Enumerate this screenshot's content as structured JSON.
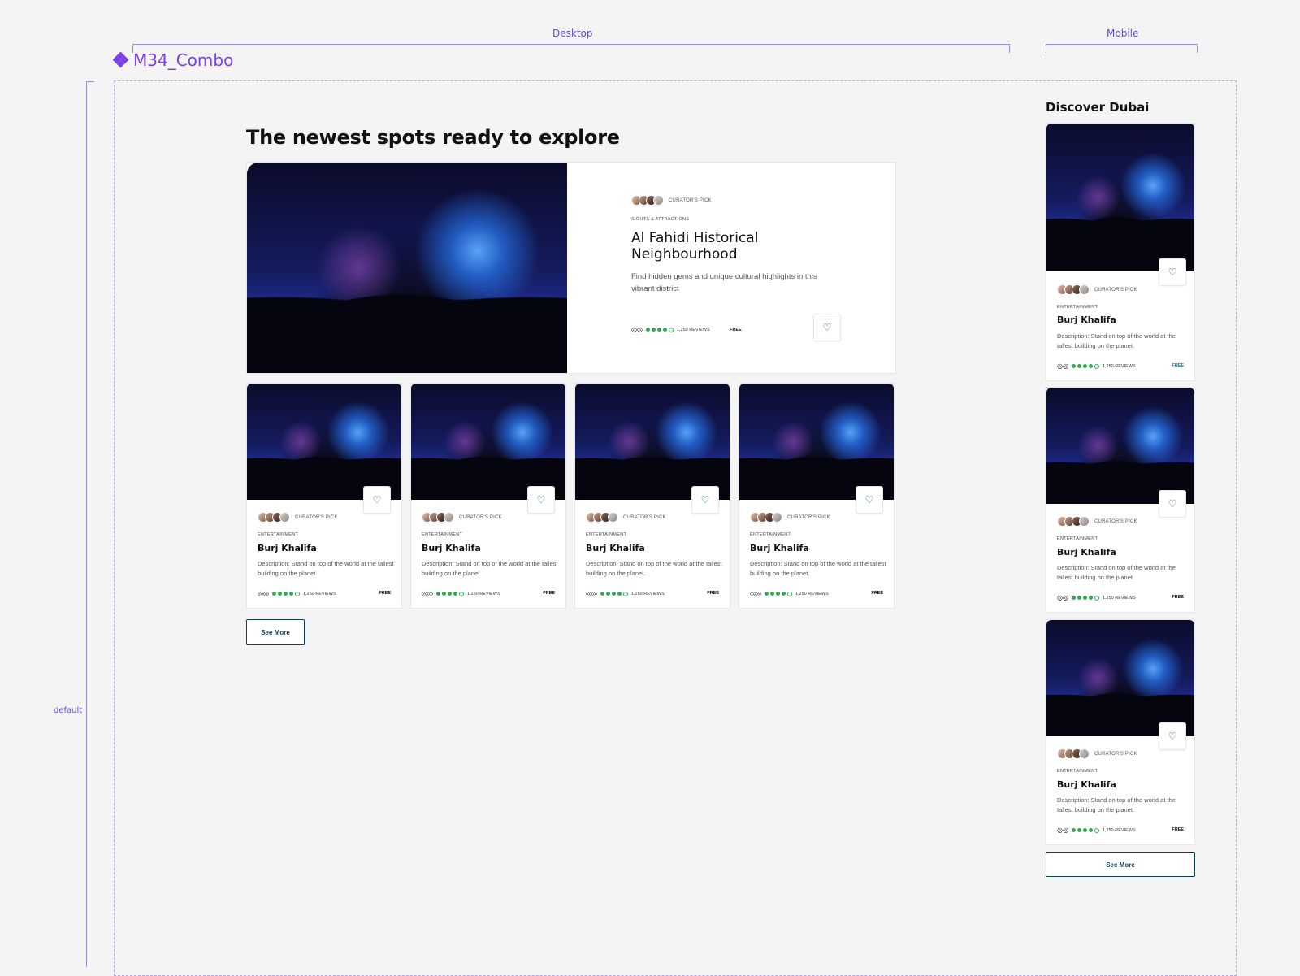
{
  "annotations": {
    "desktop_label": "Desktop",
    "mobile_label": "Mobile",
    "component_name": "M34_Combo",
    "variant_label": "default"
  },
  "desktop": {
    "heading": "The newest spots ready to explore",
    "hero": {
      "curator_label": "CURATOR'S PICK",
      "category": "SIGHTS & ATTRACTIONS",
      "title": "Al Fahidi Historical Neighbourhood",
      "description": "Find hidden gems and unique cultural highlights in this vibrant district",
      "reviews": "1,250 REVIEWS",
      "price": "FREE",
      "rating": 4,
      "rating_max": 5
    },
    "cards": [
      {
        "curator_label": "CURATOR'S PICK",
        "category": "ENTERTAINMENT",
        "title": "Burj Khalifa",
        "description": "Description: Stand on top of the world at the tallest building on the planet.",
        "reviews": "1,250 REVIEWS",
        "price": "FREE",
        "rating": 4
      },
      {
        "curator_label": "CURATOR'S PICK",
        "category": "ENTERTAINMENT",
        "title": "Burj Khalifa",
        "description": "Description: Stand on top of the world at the tallest building on the planet.",
        "reviews": "1,250 REVIEWS",
        "price": "FREE",
        "rating": 4
      },
      {
        "curator_label": "CURATOR'S PICK",
        "category": "ENTERTAINMENT",
        "title": "Burj Khalifa",
        "description": "Description: Stand on top of the world at the tallest building on the planet.",
        "reviews": "1,250 REVIEWS",
        "price": "FREE",
        "rating": 4
      },
      {
        "curator_label": "CURATOR'S PICK",
        "category": "ENTERTAINMENT",
        "title": "Burj Khalifa",
        "description": "Description: Stand on top of the world at the tallest building on the planet.",
        "reviews": "1,250 REVIEWS",
        "price": "FREE",
        "rating": 4
      }
    ],
    "see_more": "See More"
  },
  "mobile": {
    "heading": "Discover Dubai",
    "cards": [
      {
        "curator_label": "CURATOR'S PICK",
        "category": "ENTERTAINMENT",
        "title": "Burj Khalifa",
        "description": "Description: Stand on top of the world at the tallest building on the planet.",
        "reviews": "1,250 REVIEWS",
        "price": "FREE",
        "rating": 4
      },
      {
        "curator_label": "CURATOR'S PICK",
        "category": "ENTERTAINMENT",
        "title": "Burj Khalifa",
        "description": "Description: Stand on top of the world at the tallest building on the planet.",
        "reviews": "1,250 REVIEWS",
        "price": "FREE",
        "rating": 4
      },
      {
        "curator_label": "CURATOR'S PICK",
        "category": "ENTERTAINMENT",
        "title": "Burj Khalifa",
        "description": "Description: Stand on top of the world at the tallest building on the planet.",
        "reviews": "1,250 REVIEWS",
        "price": "FREE",
        "rating": 4
      }
    ],
    "see_more": "See More"
  },
  "colors": {
    "accent_purple": "#7b3fe4",
    "rating_green": "#34a853",
    "button_navy": "#0f3e57"
  },
  "icons": {
    "heart": "heart-icon",
    "tripadvisor": "owl-icon",
    "component": "component-diamond-icon"
  }
}
